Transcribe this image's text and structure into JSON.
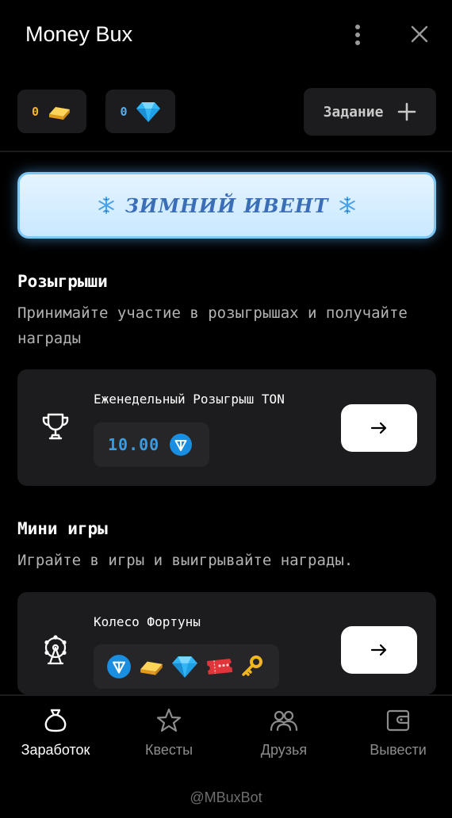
{
  "header": {
    "title": "Money Bux",
    "menu_icon": "kebab-menu-icon",
    "close_icon": "close-icon"
  },
  "balances": {
    "gold": {
      "value": "0",
      "icon": "gold-bar-icon",
      "color": "#f4b23a"
    },
    "gem": {
      "value": "0",
      "icon": "diamond-icon",
      "color": "#5aaee8"
    }
  },
  "task_button": {
    "label": "Задание",
    "icon": "plus-icon"
  },
  "event_banner": {
    "label": "ЗИМНИЙ ИВЕНТ",
    "icon": "snowflake-icon"
  },
  "giveaways": {
    "title": "Розыгрыши",
    "description": "Принимайте участие в розыгрышах и получайте награды",
    "card": {
      "title": "Еженедельный Розыгрыш TON",
      "prize": "10.00",
      "prize_icon": "ton-coin-icon",
      "icon": "trophy-icon",
      "action_icon": "arrow-right-icon"
    }
  },
  "mini_games": {
    "title": "Мини игры",
    "description": "Играйте в игры и выигрывайте награды.",
    "card": {
      "title": "Колесо Фортуны",
      "icon": "ferris-wheel-icon",
      "rewards": [
        "ton-coin-icon",
        "gold-bar-icon",
        "diamond-icon",
        "ticket-icon",
        "key-icon"
      ],
      "action_icon": "arrow-right-icon"
    }
  },
  "nav": {
    "items": [
      {
        "label": "Заработок",
        "icon": "money-bag-icon",
        "active": true
      },
      {
        "label": "Квесты",
        "icon": "star-icon",
        "active": false
      },
      {
        "label": "Друзья",
        "icon": "friends-icon",
        "active": false
      },
      {
        "label": "Вывести",
        "icon": "wallet-icon",
        "active": false
      }
    ]
  },
  "footer": {
    "handle": "@MBuxBot"
  },
  "colors": {
    "background": "#000000",
    "card": "#1c1c1e",
    "accent_blue": "#3b9be0",
    "event_text": "#3a6fb8"
  }
}
